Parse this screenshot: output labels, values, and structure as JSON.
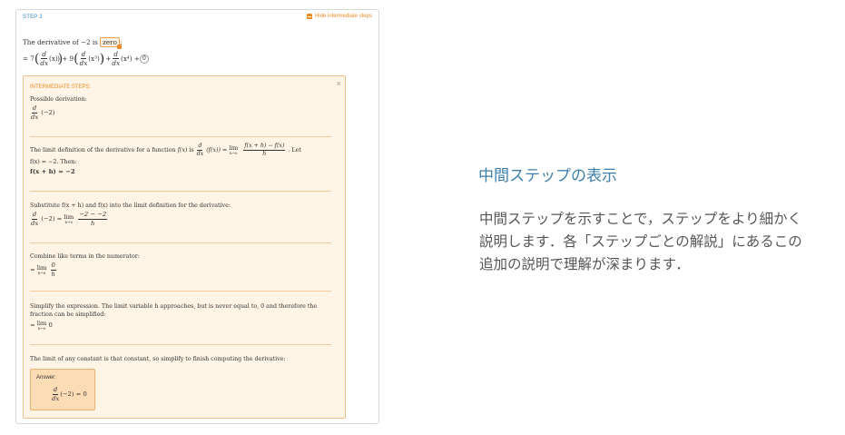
{
  "step": {
    "label": "STEP 3",
    "hide_link": "Hide intermediate steps",
    "line1_prefix": "The derivative of −2 is",
    "line1_value": "zero",
    "line1_suffix": ":",
    "line2": {
      "eq": "= 7",
      "d": "d",
      "dx": "dx",
      "x1": "(x)",
      "plus9": ") + 9",
      "x3": "(x³)",
      "plus": ") +",
      "x4": "(x⁴) +",
      "zero": "0"
    }
  },
  "intermediate": {
    "title": "INTERMEDIATE STEPS:",
    "close": "×",
    "s1_text": "Possible derivation:",
    "s1_math": "(−2)",
    "s2_text_a": "The limit definition of the derivative for a function",
    "s2_fx": "f(x)",
    "s2_is": "is",
    "s2_dfx": "(f(x)) =",
    "s2_lim": "lim",
    "s2_limsub": "h→0",
    "s2_num": "f(x + h) − f(x)",
    "s2_den": "h",
    "s2_let": ". Let",
    "s2_then": "f(x) = −2. Then:",
    "s2_bold": "f(x + h) = −2",
    "s3_text": "Substitute f(x + h) and f(x) into the limit definition for the derivative:",
    "s3_eq": "(−2) =",
    "s3_num": "−2 − −2",
    "s4_text": "Combine like terms in the numerator:",
    "s4_eq": "=",
    "s4_num": "0",
    "s5_text": "Simplify the expression. The limit variable h approaches, but is never equal to, 0 and therefore the fraction can be simplified:",
    "s5_val": "0",
    "s6_text": "The limit of any constant is that constant, so simplify to finish computing the derivative:",
    "answer_label": "Answer:",
    "answer_math": "(−2) = 0"
  },
  "sidebar": {
    "title": "中間ステップの表示",
    "text": "中間ステップを示すことで，ステップをより細かく説明します．各「ステップごとの解説」にあるこの追加の説明で理解が深まります．"
  }
}
